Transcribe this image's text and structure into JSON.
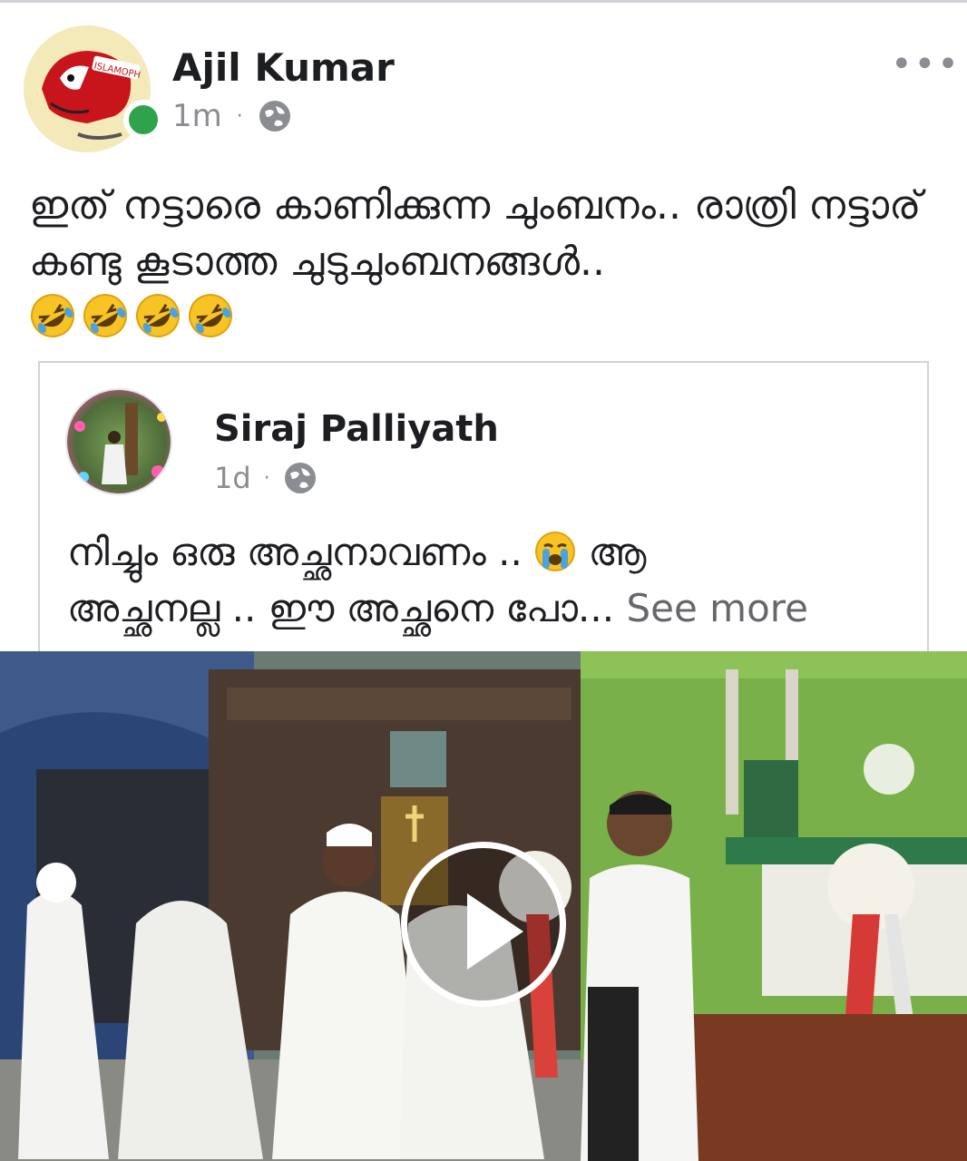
{
  "post": {
    "author": "Ajil Kumar",
    "time": "1m",
    "separator": "·",
    "more_label": "•••",
    "caption": "ഇത് നട്ടാരെ കാണിക്കുന്ന ചുംബനം.. രാത്രി നട്ടാര് കണ്ടു കൂടാത്ത ചുടുചുംബനങ്ങൾ..",
    "emoji_count": 4,
    "emoji_name": "rolling-on-floor-laughing",
    "online": true
  },
  "shared": {
    "author": "Siraj Palliyath",
    "time": "1d",
    "separator": "·",
    "text_line1_before": "നിച്ചും ഒരു അച്ഛനാവണം ..",
    "text_line1_after": " ആ",
    "text_line2": "അച്ഛനല്ല .. ഈ അച്ഛനെ പോ...",
    "see_more": " See more",
    "inline_emoji": "loudly-crying-face"
  },
  "video": {
    "play_icon": "play-icon"
  },
  "colors": {
    "online_green": "#31a24c",
    "meta_gray": "#8a8d91",
    "text": "#1c1e21"
  }
}
